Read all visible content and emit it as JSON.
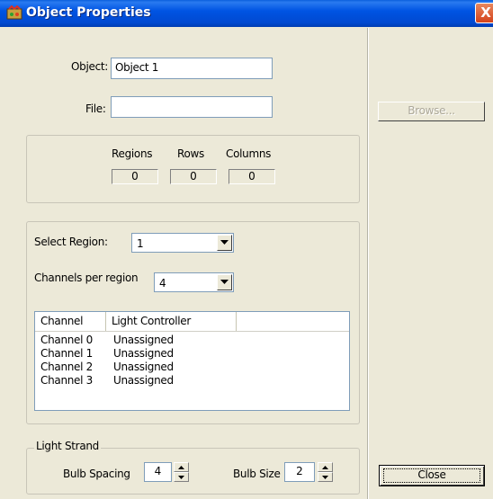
{
  "window": {
    "title": "Object Properties",
    "close_glyph": "X",
    "title_icon": "app-icon"
  },
  "form": {
    "object_label": "Object:",
    "object_value": "Object 1",
    "file_label": "File:",
    "file_value": "",
    "browse_label": "Browse..."
  },
  "stats": {
    "regions_label": "Regions",
    "rows_label": "Rows",
    "columns_label": "Columns",
    "regions_value": "0",
    "rows_value": "0",
    "columns_value": "0"
  },
  "region": {
    "select_label": "Select Region:",
    "select_value": "1",
    "channels_label": "Channels per region",
    "channels_value": "4"
  },
  "channels_list": {
    "columns": [
      "Channel",
      "Light Controller"
    ],
    "rows": [
      {
        "channel": "Channel 0",
        "controller": "Unassigned"
      },
      {
        "channel": "Channel 1",
        "controller": "Unassigned"
      },
      {
        "channel": "Channel 2",
        "controller": "Unassigned"
      },
      {
        "channel": "Channel 3",
        "controller": "Unassigned"
      }
    ]
  },
  "light_strand": {
    "group_label": "Light Strand",
    "bulb_spacing_label": "Bulb Spacing",
    "bulb_spacing_value": "4",
    "bulb_size_label": "Bulb Size",
    "bulb_size_value": "2"
  },
  "close_label": "Close",
  "colors": {
    "titlebar": "#0054e3",
    "dialog_bg": "#ece9d8",
    "close_button": "#d4421a"
  }
}
